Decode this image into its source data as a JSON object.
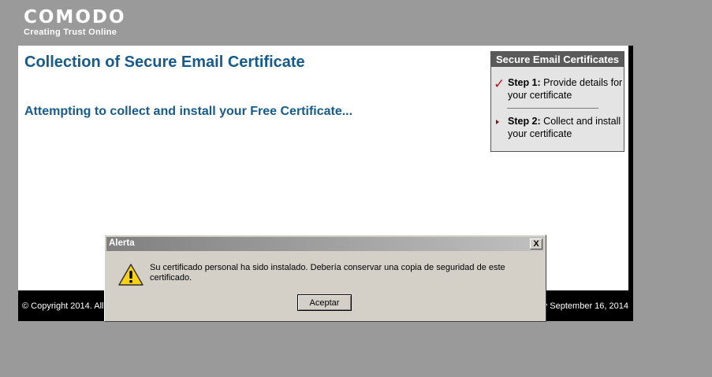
{
  "brand": {
    "logo": "COMODO",
    "tagline": "Creating Trust Online"
  },
  "main": {
    "title": "Collection of Secure Email Certificate",
    "status": "Attempting to collect and install your Free Certificate..."
  },
  "steps_panel": {
    "header": "Secure Email Certificates",
    "steps": [
      {
        "label": "Step 1:",
        "text": "Provide details for your certificate",
        "state": "completed",
        "icon": "check-icon"
      },
      {
        "label": "Step 2:",
        "text": "Collect and install your certificate",
        "state": "current",
        "icon": "arrow-icon"
      }
    ]
  },
  "footer": {
    "left": "© Copyright 2014. All",
    "right": "y September 16, 2014"
  },
  "dialog": {
    "title": "Alerta",
    "close_label": "X",
    "icon": "warning-icon",
    "message": "Su certificado personal ha sido instalado. Debería conservar una copia de seguridad de este certificado.",
    "ok_label": "Aceptar"
  },
  "colors": {
    "accent": "#155b8e",
    "check": "#c0151e",
    "panel_header": "#5a5a5a",
    "background": "#9a9a9a"
  }
}
